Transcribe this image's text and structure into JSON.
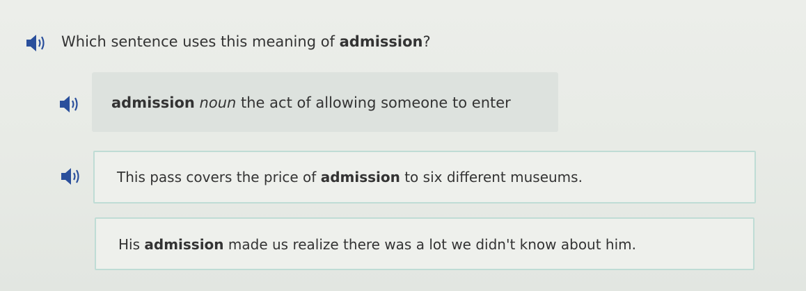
{
  "question": {
    "prefix": "Which sentence uses this meaning of ",
    "word": "admission",
    "suffix": "?"
  },
  "definition": {
    "word": "admission",
    "part_of_speech": "noun",
    "meaning": "the act of allowing someone to enter"
  },
  "choices": [
    {
      "before": "This pass covers the price of ",
      "word": "admission",
      "after": " to six different museums."
    },
    {
      "before": "His ",
      "word": "admission",
      "after": " made us realize there was a lot we didn't know about him."
    }
  ],
  "icons": {
    "audio": "speaker-icon",
    "accent": "#2a4f9c"
  }
}
